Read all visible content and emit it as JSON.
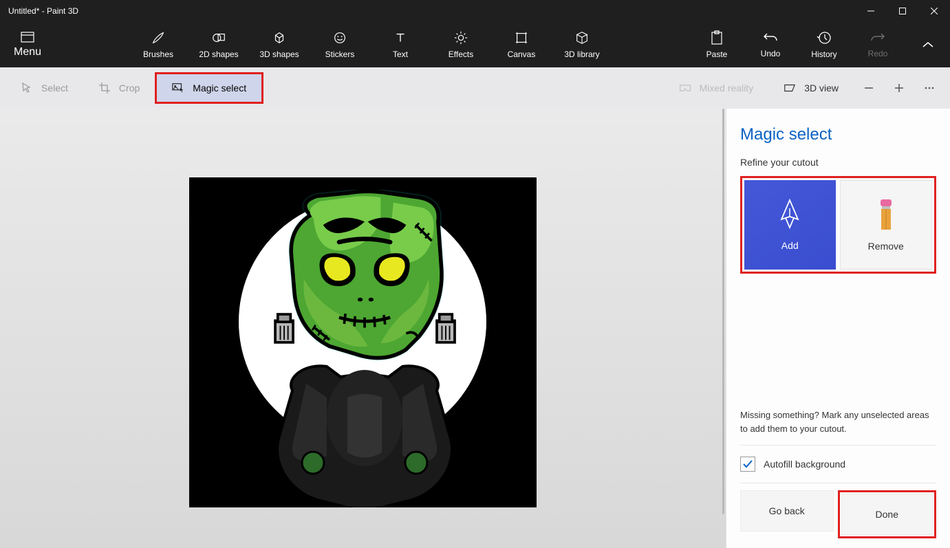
{
  "window": {
    "title": "Untitled* - Paint 3D"
  },
  "ribbon": {
    "menu": "Menu",
    "tools": [
      "Brushes",
      "2D shapes",
      "3D shapes",
      "Stickers",
      "Text",
      "Effects",
      "Canvas",
      "3D library"
    ],
    "right": [
      {
        "label": "Paste",
        "disabled": false
      },
      {
        "label": "Undo",
        "disabled": false
      },
      {
        "label": "History",
        "disabled": false
      },
      {
        "label": "Redo",
        "disabled": true
      }
    ]
  },
  "subbar": {
    "select": "Select",
    "crop": "Crop",
    "magic_select": "Magic select",
    "mixed_reality": "Mixed reality",
    "view_3d": "3D view"
  },
  "panel": {
    "title": "Magic select",
    "subtitle": "Refine your cutout",
    "add": "Add",
    "remove": "Remove",
    "hint": "Missing something? Mark any unselected areas to add them to your cutout.",
    "autofill": "Autofill background",
    "go_back": "Go back",
    "done": "Done"
  }
}
